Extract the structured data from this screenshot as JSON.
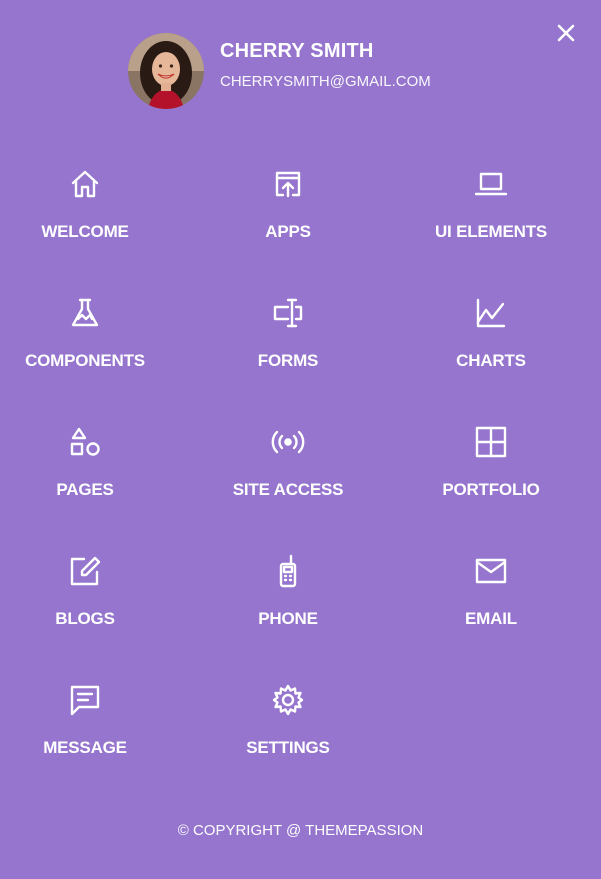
{
  "profile": {
    "name": "CHERRY SMITH",
    "email": "CHERRYSMITH@GMAIL.COM"
  },
  "close_icon": "close-icon",
  "menu": [
    {
      "label": "WELCOME",
      "icon": "home-icon"
    },
    {
      "label": "APPS",
      "icon": "open-in-browser-icon"
    },
    {
      "label": "UI ELEMENTS",
      "icon": "laptop-icon"
    },
    {
      "label": "COMPONENTS",
      "icon": "flask-icon"
    },
    {
      "label": "FORMS",
      "icon": "form-textbox-icon"
    },
    {
      "label": "CHARTS",
      "icon": "line-chart-icon"
    },
    {
      "label": "PAGES",
      "icon": "shapes-icon"
    },
    {
      "label": "SITE ACCESS",
      "icon": "broadcast-icon"
    },
    {
      "label": "PORTFOLIO",
      "icon": "grid-icon"
    },
    {
      "label": "BLOGS",
      "icon": "edit-icon"
    },
    {
      "label": "PHONE",
      "icon": "mobile-phone-icon"
    },
    {
      "label": "EMAIL",
      "icon": "email-icon"
    },
    {
      "label": "MESSAGE",
      "icon": "message-icon"
    },
    {
      "label": "SETTINGS",
      "icon": "gear-icon"
    }
  ],
  "footer": {
    "copyright": "© COPYRIGHT @ THEMEPASSION"
  },
  "colors": {
    "background": "#9575cd",
    "foreground": "#ffffff"
  }
}
